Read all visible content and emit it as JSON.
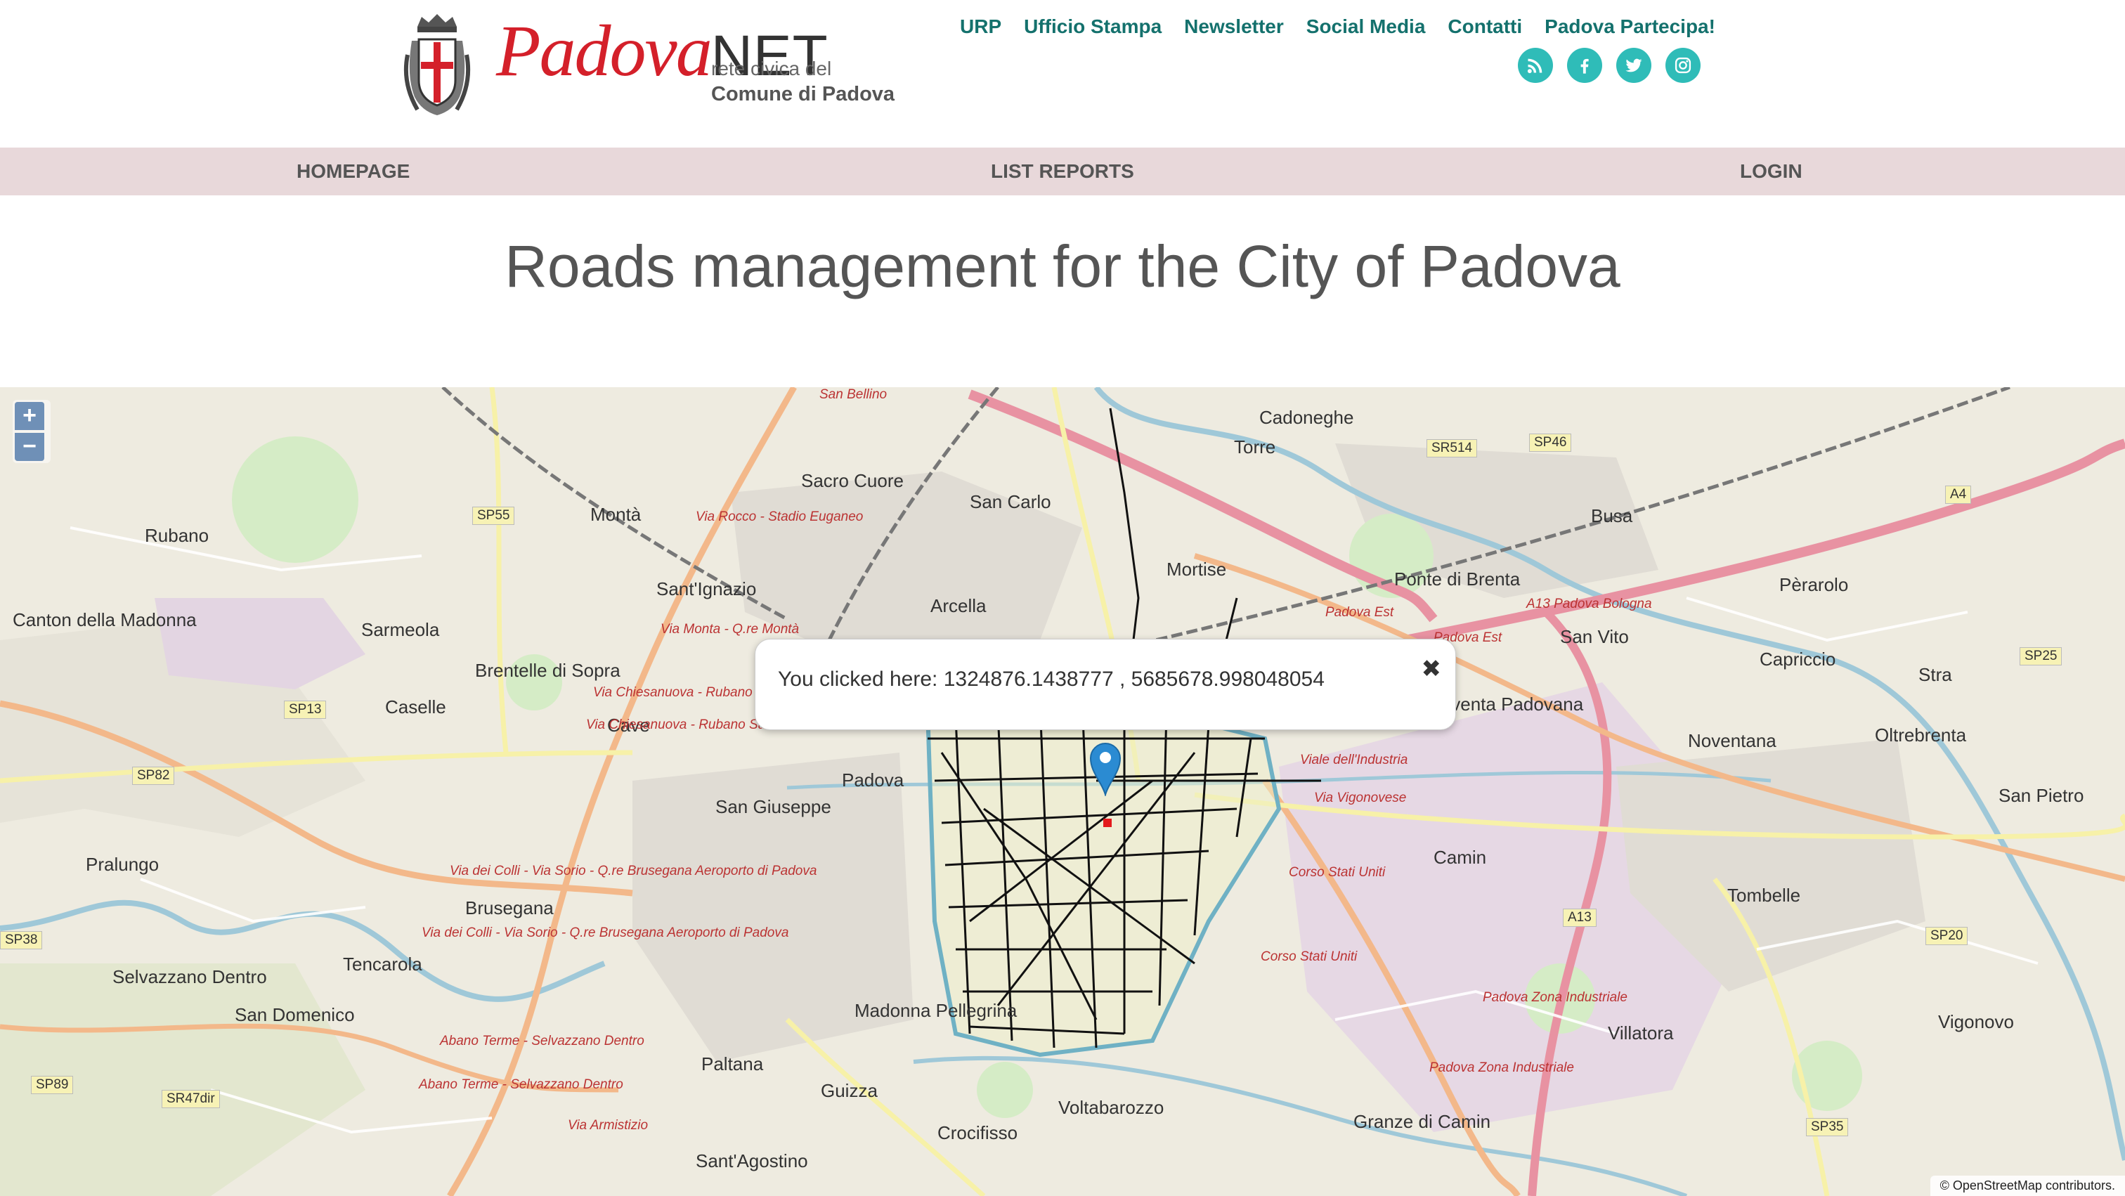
{
  "header": {
    "logo_part1": "Padova",
    "logo_part2": "NET",
    "rete": "rete civica del",
    "comune": "Comune di Padova",
    "links": [
      "URP",
      "Ufficio Stampa",
      "Newsletter",
      "Social Media",
      "Contatti",
      "Padova Partecipa!"
    ],
    "socials": [
      "rss-icon",
      "facebook-icon",
      "twitter-icon",
      "instagram-icon"
    ],
    "link_color": "#14716d",
    "social_color": "#2fbcb8"
  },
  "nav": {
    "homepage": "HOMEPAGE",
    "list_reports": "LIST REPORTS",
    "login": "LOGIN",
    "background": "#e8d8da"
  },
  "title": "Roads management for the City of Padova",
  "map": {
    "zoom_in": "+",
    "zoom_out": "−",
    "popup": {
      "message": "You clicked here: 1324876.1438777 , 5685678.998048054",
      "close": "✖"
    },
    "attribution": "© OpenStreetMap contributors.",
    "places": [
      "Rubano",
      "Canton della Madonna",
      "Sarmeola",
      "Caselle",
      "Brentelle di Sopra",
      "Montà",
      "Sant'Ignazio",
      "Sacro Cuore",
      "San Carlo",
      "Arcella",
      "Cadoneghe",
      "Torre",
      "Mortise",
      "Ponte di Brenta",
      "Busa",
      "Pèrarolo",
      "San Vito",
      "Capriccio",
      "Stra",
      "Noventa Padovana",
      "Noventana",
      "Oltrebrenta",
      "San Pietro",
      "Cave",
      "Padova",
      "San Giuseppe",
      "Pralungo",
      "Brusegana",
      "Tencarola",
      "Selvazzano Dentro",
      "San Domenico",
      "Paltana",
      "Madonna Pellegrina",
      "Guizza",
      "Crocifisso",
      "Voltabarozzo",
      "Sant'Agostino",
      "Granze di Camin",
      "Camin",
      "Tombelle",
      "Villatora",
      "Vigonovo"
    ],
    "roads": [
      "Via Rocco - Stadio Euganeo",
      "Via Monta - Q.re Montà",
      "Via Chiesanuova - Rubano",
      "Via Chiesanuova - Rubano Sarmeola",
      "Via dei Colli - Via Sorio - Q.re Brusegana Aeroporto di Padova",
      "Via dei Colli - Via Sorio - Q.re Brusegana Aeroporto di Padova",
      "Abano Terme - Selvazzano Dentro",
      "Abano Terme - Selvazzano Dentro",
      "Via Armistizio",
      "Corso Stati Uniti",
      "Corso Stati Uniti",
      "Padova Zona Industriale",
      "Padova Zona Industriale",
      "Viale dell'Industria",
      "Via Vigonovese",
      "Padova Est",
      "Padova Est",
      "A13 Padova Bologna",
      "San Bellino"
    ],
    "shields": [
      "SP55",
      "SP13",
      "SP82",
      "SP38",
      "SP89",
      "SR47dir",
      "SR514",
      "SP46",
      "A4",
      "SP25",
      "A13",
      "SP20",
      "SP35"
    ]
  }
}
